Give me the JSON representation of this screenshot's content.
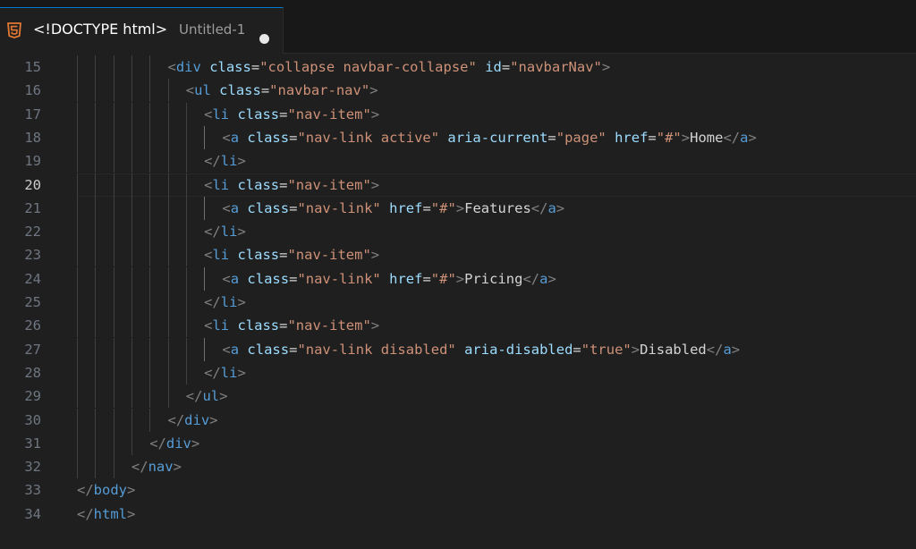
{
  "tab": {
    "title": "<!DOCTYPE html>",
    "file": "Untitled-1",
    "icon": "html5-icon",
    "dirty": true
  },
  "editor": {
    "current_line": 20,
    "lines": [
      {
        "n": "15",
        "indent": 5,
        "tokens": [
          [
            "p",
            "<"
          ],
          [
            "t",
            "div"
          ],
          [
            "x",
            " "
          ],
          [
            "a",
            "class"
          ],
          [
            "x",
            "="
          ],
          [
            "s",
            "\"collapse navbar-collapse\""
          ],
          [
            "x",
            " "
          ],
          [
            "a",
            "id"
          ],
          [
            "x",
            "="
          ],
          [
            "s",
            "\"navbarNav\""
          ],
          [
            "p",
            ">"
          ]
        ]
      },
      {
        "n": "16",
        "indent": 6,
        "tokens": [
          [
            "p",
            "<"
          ],
          [
            "t",
            "ul"
          ],
          [
            "x",
            " "
          ],
          [
            "a",
            "class"
          ],
          [
            "x",
            "="
          ],
          [
            "s",
            "\"navbar-nav\""
          ],
          [
            "p",
            ">"
          ]
        ]
      },
      {
        "n": "17",
        "indent": 7,
        "tokens": [
          [
            "p",
            "<"
          ],
          [
            "t",
            "li"
          ],
          [
            "x",
            " "
          ],
          [
            "a",
            "class"
          ],
          [
            "x",
            "="
          ],
          [
            "s",
            "\"nav-item\""
          ],
          [
            "p",
            ">"
          ]
        ]
      },
      {
        "n": "18",
        "indent": 8,
        "tokens": [
          [
            "p",
            "<"
          ],
          [
            "t",
            "a"
          ],
          [
            "x",
            " "
          ],
          [
            "a",
            "class"
          ],
          [
            "x",
            "="
          ],
          [
            "s",
            "\"nav-link active\""
          ],
          [
            "x",
            " "
          ],
          [
            "a",
            "aria-current"
          ],
          [
            "x",
            "="
          ],
          [
            "s",
            "\"page\""
          ],
          [
            "x",
            " "
          ],
          [
            "a",
            "href"
          ],
          [
            "x",
            "="
          ],
          [
            "s",
            "\"#\""
          ],
          [
            "p",
            ">"
          ],
          [
            "x",
            "Home"
          ],
          [
            "p",
            "</"
          ],
          [
            "t",
            "a"
          ],
          [
            "p",
            ">"
          ]
        ]
      },
      {
        "n": "19",
        "indent": 7,
        "tokens": [
          [
            "p",
            "</"
          ],
          [
            "t",
            "li"
          ],
          [
            "p",
            ">"
          ]
        ]
      },
      {
        "n": "20",
        "indent": 7,
        "tokens": [
          [
            "p",
            "<"
          ],
          [
            "t",
            "li"
          ],
          [
            "x",
            " "
          ],
          [
            "a",
            "class"
          ],
          [
            "x",
            "="
          ],
          [
            "s",
            "\"nav-item\""
          ],
          [
            "p",
            ">"
          ]
        ]
      },
      {
        "n": "21",
        "indent": 8,
        "tokens": [
          [
            "p",
            "<"
          ],
          [
            "t",
            "a"
          ],
          [
            "x",
            " "
          ],
          [
            "a",
            "class"
          ],
          [
            "x",
            "="
          ],
          [
            "s",
            "\"nav-link\""
          ],
          [
            "x",
            " "
          ],
          [
            "a",
            "href"
          ],
          [
            "x",
            "="
          ],
          [
            "s",
            "\"#\""
          ],
          [
            "p",
            ">"
          ],
          [
            "x",
            "Features"
          ],
          [
            "p",
            "</"
          ],
          [
            "t",
            "a"
          ],
          [
            "p",
            ">"
          ]
        ]
      },
      {
        "n": "22",
        "indent": 7,
        "tokens": [
          [
            "p",
            "</"
          ],
          [
            "t",
            "li"
          ],
          [
            "p",
            ">"
          ]
        ]
      },
      {
        "n": "23",
        "indent": 7,
        "tokens": [
          [
            "p",
            "<"
          ],
          [
            "t",
            "li"
          ],
          [
            "x",
            " "
          ],
          [
            "a",
            "class"
          ],
          [
            "x",
            "="
          ],
          [
            "s",
            "\"nav-item\""
          ],
          [
            "p",
            ">"
          ]
        ]
      },
      {
        "n": "24",
        "indent": 8,
        "tokens": [
          [
            "p",
            "<"
          ],
          [
            "t",
            "a"
          ],
          [
            "x",
            " "
          ],
          [
            "a",
            "class"
          ],
          [
            "x",
            "="
          ],
          [
            "s",
            "\"nav-link\""
          ],
          [
            "x",
            " "
          ],
          [
            "a",
            "href"
          ],
          [
            "x",
            "="
          ],
          [
            "s",
            "\"#\""
          ],
          [
            "p",
            ">"
          ],
          [
            "x",
            "Pricing"
          ],
          [
            "p",
            "</"
          ],
          [
            "t",
            "a"
          ],
          [
            "p",
            ">"
          ]
        ]
      },
      {
        "n": "25",
        "indent": 7,
        "tokens": [
          [
            "p",
            "</"
          ],
          [
            "t",
            "li"
          ],
          [
            "p",
            ">"
          ]
        ]
      },
      {
        "n": "26",
        "indent": 7,
        "tokens": [
          [
            "p",
            "<"
          ],
          [
            "t",
            "li"
          ],
          [
            "x",
            " "
          ],
          [
            "a",
            "class"
          ],
          [
            "x",
            "="
          ],
          [
            "s",
            "\"nav-item\""
          ],
          [
            "p",
            ">"
          ]
        ]
      },
      {
        "n": "27",
        "indent": 8,
        "tokens": [
          [
            "p",
            "<"
          ],
          [
            "t",
            "a"
          ],
          [
            "x",
            " "
          ],
          [
            "a",
            "class"
          ],
          [
            "x",
            "="
          ],
          [
            "s",
            "\"nav-link disabled\""
          ],
          [
            "x",
            " "
          ],
          [
            "a",
            "aria-disabled"
          ],
          [
            "x",
            "="
          ],
          [
            "s",
            "\"true\""
          ],
          [
            "p",
            ">"
          ],
          [
            "x",
            "Disabled"
          ],
          [
            "p",
            "</"
          ],
          [
            "t",
            "a"
          ],
          [
            "p",
            ">"
          ]
        ]
      },
      {
        "n": "28",
        "indent": 7,
        "tokens": [
          [
            "p",
            "</"
          ],
          [
            "t",
            "li"
          ],
          [
            "p",
            ">"
          ]
        ]
      },
      {
        "n": "29",
        "indent": 6,
        "tokens": [
          [
            "p",
            "</"
          ],
          [
            "t",
            "ul"
          ],
          [
            "p",
            ">"
          ]
        ]
      },
      {
        "n": "30",
        "indent": 5,
        "tokens": [
          [
            "p",
            "</"
          ],
          [
            "t",
            "div"
          ],
          [
            "p",
            ">"
          ]
        ]
      },
      {
        "n": "31",
        "indent": 4,
        "tokens": [
          [
            "p",
            "</"
          ],
          [
            "t",
            "div"
          ],
          [
            "p",
            ">"
          ]
        ]
      },
      {
        "n": "32",
        "indent": 3,
        "tokens": [
          [
            "p",
            "</"
          ],
          [
            "t",
            "nav"
          ],
          [
            "p",
            ">"
          ]
        ]
      },
      {
        "n": "33",
        "indent": 0,
        "tokens": [
          [
            "p",
            "</"
          ],
          [
            "t",
            "body"
          ],
          [
            "p",
            ">"
          ]
        ]
      },
      {
        "n": "34",
        "indent": 0,
        "tokens": [
          [
            "p",
            "</"
          ],
          [
            "t",
            "html"
          ],
          [
            "p",
            ">"
          ]
        ]
      }
    ]
  }
}
